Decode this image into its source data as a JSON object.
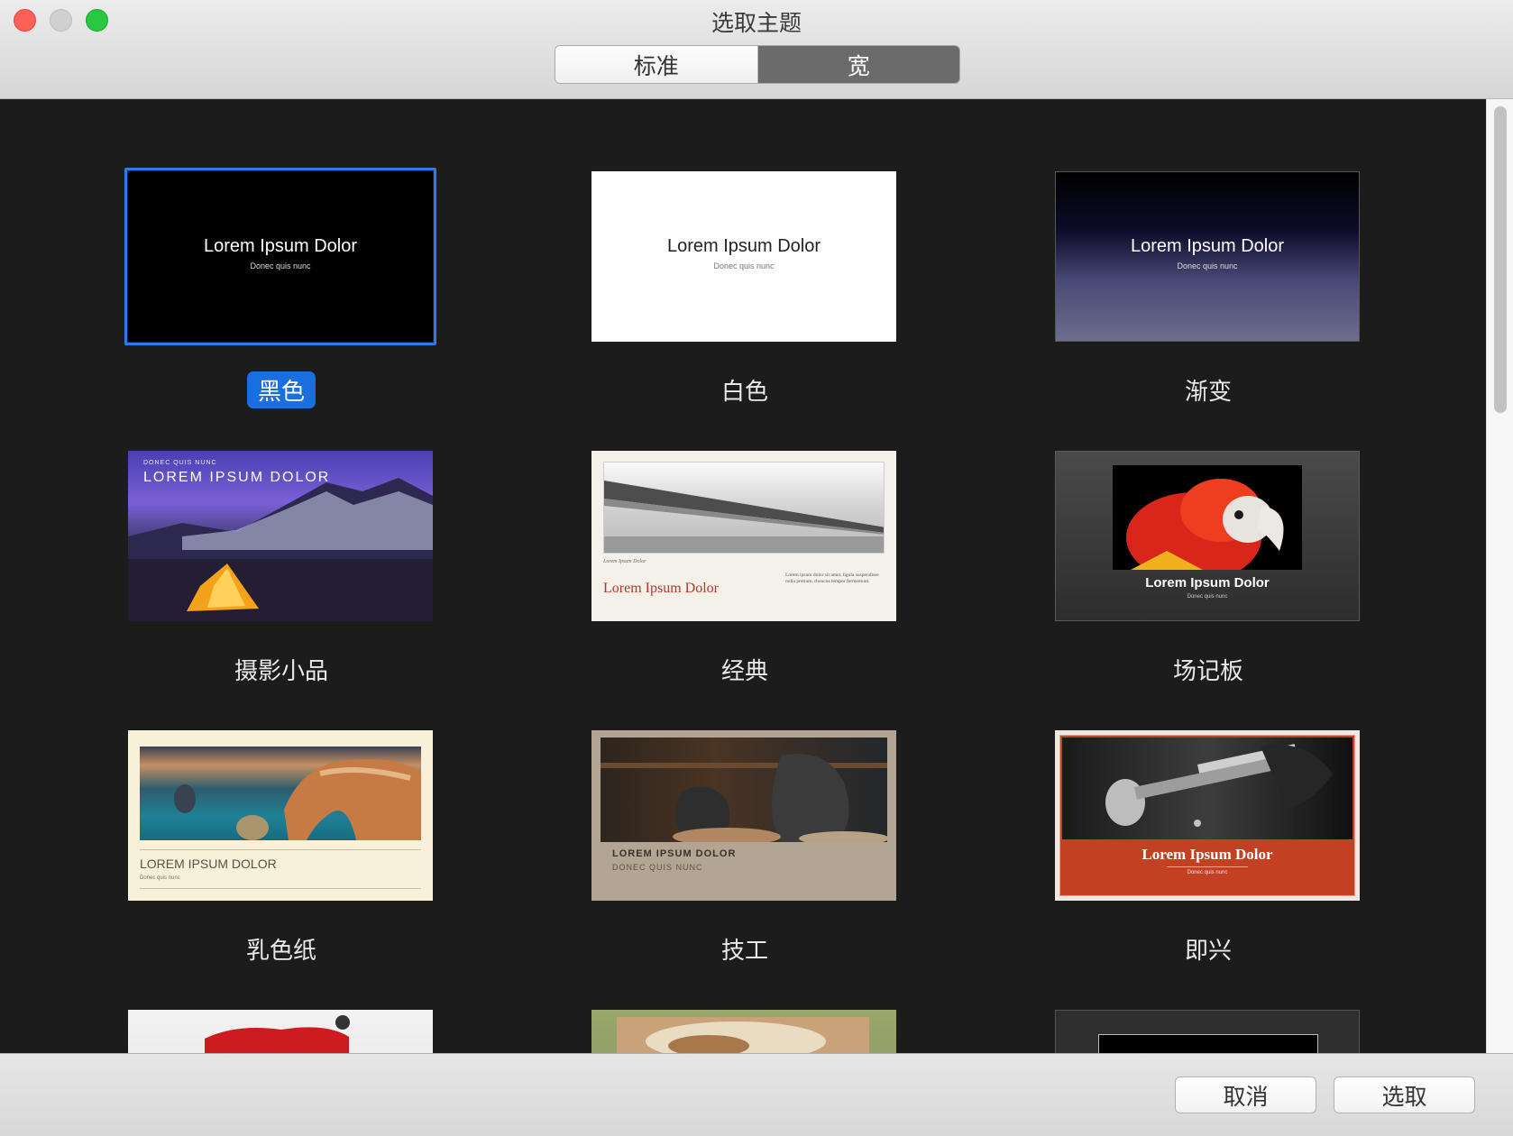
{
  "window": {
    "title": "选取主题"
  },
  "tabs": [
    {
      "label": "标准",
      "selected": false
    },
    {
      "label": "宽",
      "selected": true
    }
  ],
  "themes": [
    {
      "label": "黑色",
      "selected": true,
      "title": "Lorem Ipsum Dolor",
      "subtitle": "Donec quis nunc"
    },
    {
      "label": "白色",
      "selected": false,
      "title": "Lorem Ipsum Dolor",
      "subtitle": "Donec quis nunc"
    },
    {
      "label": "渐变",
      "selected": false,
      "title": "Lorem Ipsum Dolor",
      "subtitle": "Donec quis nunc"
    },
    {
      "label": "摄影小品",
      "selected": false,
      "title": "LOREM IPSUM DOLOR",
      "subtitle": "DONEC QUIS NUNC"
    },
    {
      "label": "经典",
      "selected": false,
      "title": "Lorem Ipsum Dolor",
      "subtitle": "Lorem Ipsum Dolor",
      "body": "Lorem ipsum dolor sit amet, ligula suspendisse nulla pretium, rhoncus tempor fermentum."
    },
    {
      "label": "场记板",
      "selected": false,
      "title": "Lorem Ipsum Dolor",
      "subtitle": "Donec quis nunc"
    },
    {
      "label": "乳色纸",
      "selected": false,
      "title": "LOREM IPSUM DOLOR",
      "subtitle": "Donec quis nunc"
    },
    {
      "label": "技工",
      "selected": false,
      "title": "LOREM IPSUM DOLOR",
      "subtitle": "DONEC QUIS NUNC"
    },
    {
      "label": "即兴",
      "selected": false,
      "title": "Lorem Ipsum Dolor",
      "subtitle": "Donec quis nunc"
    }
  ],
  "buttons": {
    "cancel": "取消",
    "choose": "选取"
  },
  "colors": {
    "accent": "#1b6ee0",
    "classic_title": "#b5362b",
    "improv_red": "#c24122"
  }
}
